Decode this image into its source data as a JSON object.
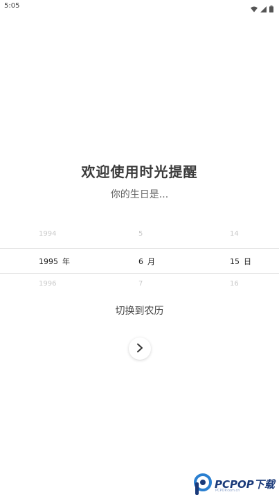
{
  "status_bar": {
    "time": "5:05",
    "icons": [
      "wifi-icon",
      "signal-icon",
      "battery-icon"
    ]
  },
  "welcome": {
    "title": "欢迎使用时光提醒",
    "subtitle": "你的生日是..."
  },
  "birthday_picker": {
    "year": {
      "prev": "1994",
      "selected": "1995",
      "next": "1996",
      "unit": "年"
    },
    "month": {
      "prev": "5",
      "selected": "6",
      "next": "7",
      "unit": "月"
    },
    "day": {
      "prev": "14",
      "selected": "15",
      "next": "16",
      "unit": "日"
    }
  },
  "lunar_toggle_label": "切换到农历",
  "next_button_icon": "chevron-right-icon",
  "watermark": {
    "text": "PCPOP下载",
    "subtext": "PCPOP.com.cn"
  },
  "colors": {
    "background": "#ffffff",
    "title": "#3a3a3a",
    "selected_text": "#222222",
    "faded_text": "#c8c8c8",
    "watermark_blue": "#1a3a7a"
  }
}
